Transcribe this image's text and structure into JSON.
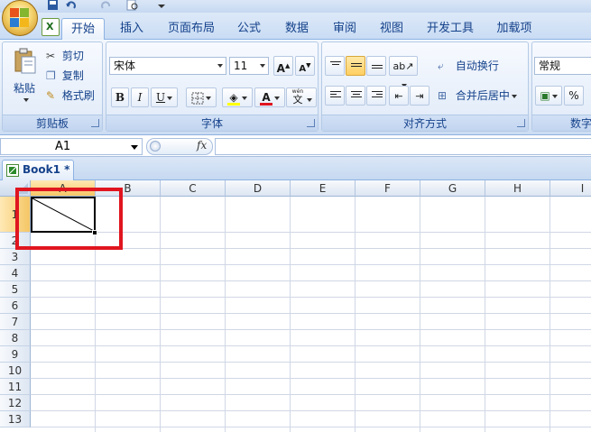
{
  "ribbon": {
    "tabs": [
      {
        "label": "开始",
        "active": true
      },
      {
        "label": "插入"
      },
      {
        "label": "页面布局"
      },
      {
        "label": "公式"
      },
      {
        "label": "数据"
      },
      {
        "label": "审阅"
      },
      {
        "label": "视图"
      },
      {
        "label": "开发工具"
      },
      {
        "label": "加载项"
      }
    ],
    "clipboard": {
      "paste": "粘贴",
      "cut": "剪切",
      "copy": "复制",
      "format_painter": "格式刷",
      "label": "剪贴板"
    },
    "font": {
      "family": "宋体",
      "size": "11",
      "bold": "B",
      "italic": "I",
      "underline": "U",
      "font_color_glyph": "A",
      "wen_top": "wén",
      "wen_char": "文",
      "label": "字体"
    },
    "alignment": {
      "wrap_text": "自动换行",
      "merge_center": "合并后居中",
      "label": "对齐方式"
    },
    "number": {
      "format": "常规",
      "percent": "%",
      "label": "数字"
    }
  },
  "formula_bar": {
    "name_box": "A1",
    "fx": "fx",
    "value": ""
  },
  "workbook": {
    "tab_label": "Book1 *"
  },
  "sheet": {
    "columns": [
      "A",
      "B",
      "C",
      "D",
      "E",
      "F",
      "G",
      "H",
      "I"
    ],
    "rows": [
      "1",
      "2",
      "3",
      "4",
      "5",
      "6",
      "7",
      "8",
      "9",
      "10",
      "11",
      "12",
      "13"
    ],
    "selected_cell": "A1",
    "selected_cell_content": "diagonal-border",
    "highlight_color": "#e0151f"
  },
  "colors": {
    "ribbon_blue": "#15428b",
    "selection_orange": "#f5c665"
  }
}
